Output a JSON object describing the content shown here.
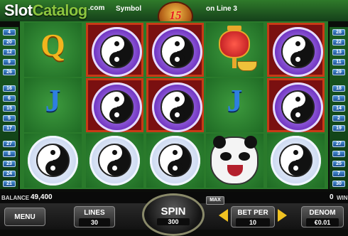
{
  "header": {
    "logo_slot": "Slot",
    "logo_catalog": "Catalog",
    "logo_com": ".com",
    "win_message_left": "Symbol",
    "win_message_right": "on Line 3",
    "free_games_badge": "15"
  },
  "paylines": {
    "left": [
      "4",
      "20",
      "12",
      "9",
      "26",
      "16",
      "6",
      "15",
      "5",
      "17",
      "27",
      "8",
      "23",
      "24",
      "21"
    ],
    "right": [
      "28",
      "22",
      "13",
      "11",
      "29",
      "18",
      "1",
      "14",
      "2",
      "19",
      "27",
      "3",
      "25",
      "7",
      "30"
    ]
  },
  "reels": [
    [
      "Q",
      "J",
      "yin-yang-white"
    ],
    [
      "yin-yang-purple",
      "yin-yang-purple",
      "yin-yang-white"
    ],
    [
      "yin-yang-purple",
      "yin-yang-purple",
      "yin-yang-white"
    ],
    [
      "lantern",
      "J",
      "panda"
    ],
    [
      "yin-yang-purple",
      "yin-yang-purple",
      "yin-yang-white"
    ]
  ],
  "status": {
    "balance_label": "BALANCE",
    "balance_value": "49,400",
    "win_value": "0",
    "win_label": "WIN"
  },
  "controls": {
    "menu_label": "MENU",
    "lines_label": "LINES",
    "lines_value": "30",
    "spin_label": "SPIN",
    "spin_value": "300",
    "max_label": "MAX",
    "bet_label": "BET PER",
    "bet_value": "10",
    "denom_label": "DENOM",
    "denom_value": "€0.01"
  },
  "colors": {
    "felt_green": "#2a7a2b",
    "win_highlight": "#c83a16",
    "arrow_gold": "#f0c222",
    "payline_blue": "#1d4f92"
  }
}
